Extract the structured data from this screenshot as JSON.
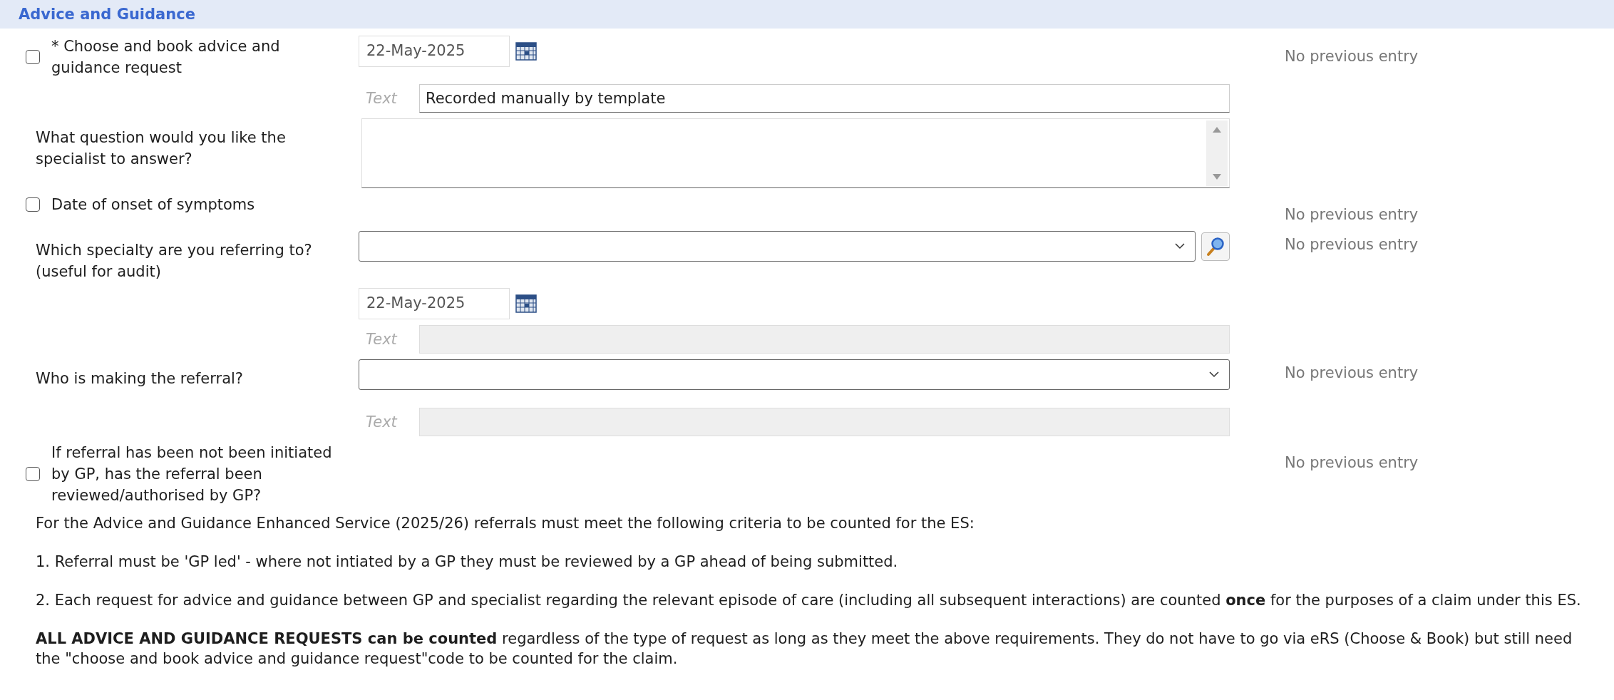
{
  "section": {
    "title": "Advice and Guidance"
  },
  "rows": [
    {
      "kind": "checkbox",
      "label": "* Choose and book advice and guidance request",
      "checked": false,
      "previous": "No previous entry",
      "control": {
        "kind": "date",
        "value": "22-May-2025"
      }
    },
    {
      "kind": "blank",
      "control": {
        "kind": "text",
        "prefix": "Text",
        "value": "Recorded manually by template",
        "disabled": false
      }
    },
    {
      "kind": "label",
      "label": "What question would you like the specialist to answer?",
      "control": {
        "kind": "textarea"
      }
    },
    {
      "kind": "checkbox",
      "label": "Date of onset of symptoms",
      "checked": false,
      "previous": "No previous entry"
    },
    {
      "kind": "label",
      "label": "Which specialty are you referring to? (useful for audit)",
      "previous": "No previous entry",
      "control": {
        "kind": "select",
        "search": true
      }
    },
    {
      "kind": "blank",
      "control": {
        "kind": "date",
        "value": "22-May-2025"
      }
    },
    {
      "kind": "blank",
      "control": {
        "kind": "text",
        "prefix": "Text",
        "disabled": true
      }
    },
    {
      "kind": "label",
      "label": "Who is making the referral?",
      "previous": "No previous entry",
      "control": {
        "kind": "select",
        "search": false
      }
    },
    {
      "kind": "blank",
      "control": {
        "kind": "text",
        "prefix": "Text",
        "disabled": true
      }
    },
    {
      "kind": "checkbox",
      "label": "If referral has been not been initiated by GP, has the referral been reviewed/authorised by GP?",
      "checked": false,
      "previous": "No previous entry"
    }
  ],
  "notes": [
    "For the Advice and Guidance Enhanced Service (2025/26) referrals must meet the following criteria to be counted for the ES:",
    "1. Referral must be 'GP led' - where not intiated by a GP they must be reviewed by a GP ahead of being submitted.",
    "2. Each request for advice and guidance between GP and specialist regarding the relevant episode of care (including all subsequent interactions) are counted **once** for the purposes of a claim under this ES.",
    "**ALL ADVICE AND GUIDANCE REQUESTS can be counted** regardless of the type of request as long as they meet the above requirements. They do not have to go via eRS (Choose & Book) but still need the \"choose and book advice and guidance request\"code to be counted for the claim."
  ]
}
